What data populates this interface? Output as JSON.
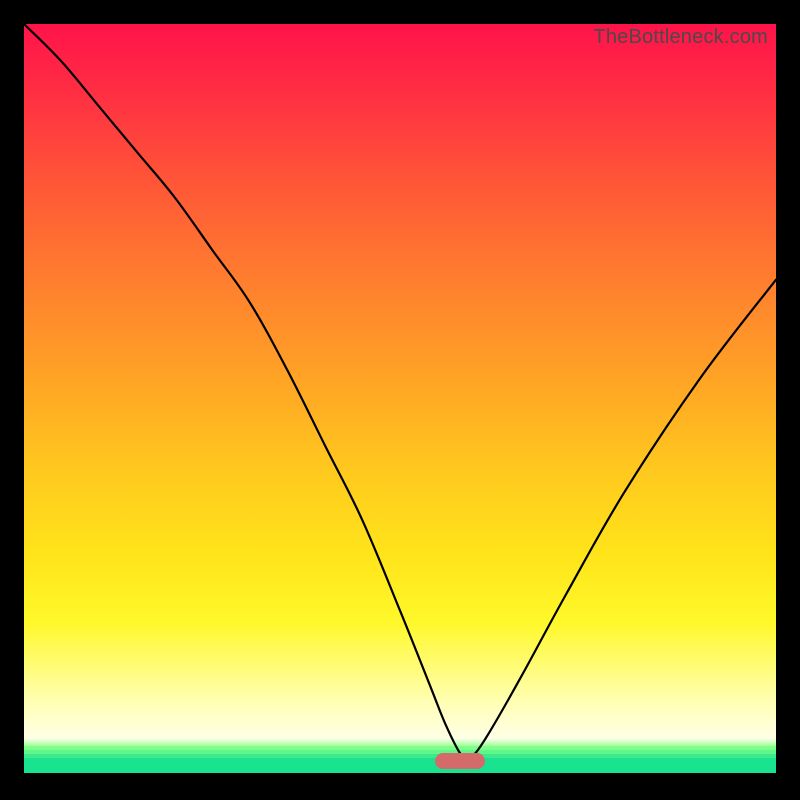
{
  "attribution": "TheBottleneck.com",
  "chart_data": {
    "type": "line",
    "title": "",
    "xlabel": "",
    "ylabel": "",
    "xlim": [
      0,
      100
    ],
    "ylim": [
      0,
      100
    ],
    "minimum_marker": {
      "x": 58,
      "y": 2
    },
    "background_gradient": {
      "stops": [
        {
          "pct": 0,
          "color": "#ff134a"
        },
        {
          "pct": 22,
          "color": "#ff5238"
        },
        {
          "pct": 52,
          "color": "#ffa325"
        },
        {
          "pct": 78,
          "color": "#ffe41a"
        },
        {
          "pct": 90,
          "color": "#ffffb7"
        },
        {
          "pct": 95,
          "color": "#ffffe6"
        },
        {
          "pct": 97,
          "color": "#7fff88"
        },
        {
          "pct": 100,
          "color": "#19e38e"
        }
      ]
    },
    "series": [
      {
        "name": "bottleneck-curve",
        "x": [
          0,
          5,
          10,
          15,
          20,
          25,
          30,
          35,
          40,
          45,
          50,
          54,
          56,
          58,
          59,
          60,
          62,
          66,
          72,
          80,
          90,
          100
        ],
        "values": [
          100,
          95,
          89,
          83,
          77,
          70,
          63,
          54,
          44,
          34,
          22,
          12,
          7,
          3,
          2.5,
          3,
          6,
          13,
          24,
          38,
          53,
          66
        ]
      }
    ]
  }
}
